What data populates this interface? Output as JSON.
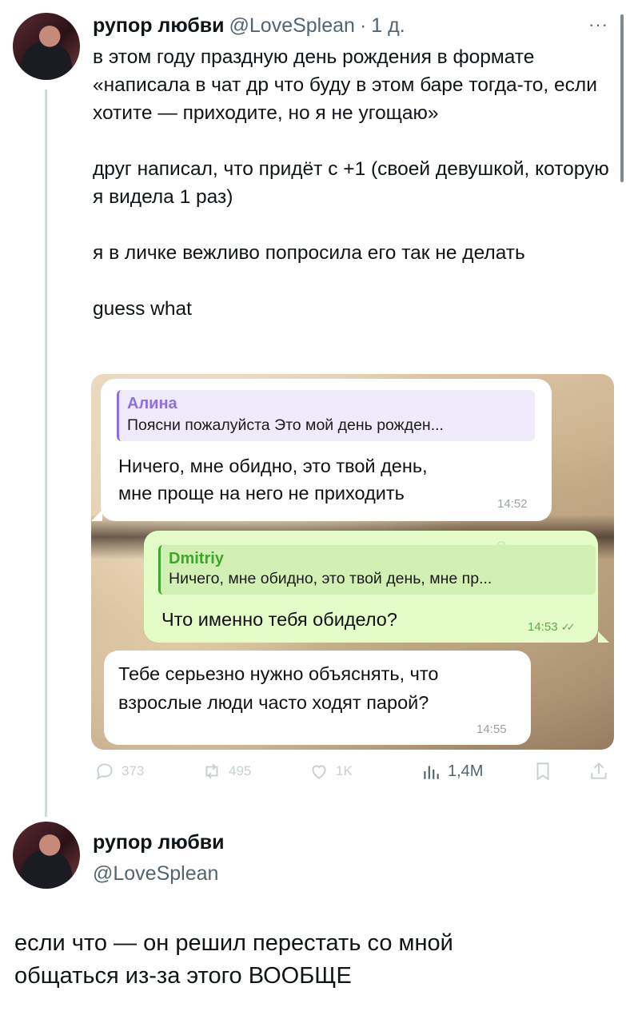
{
  "tweet1": {
    "display_name": "рупор любви",
    "handle": "@LoveSplean",
    "time_sep": "·",
    "time": "1 д.",
    "more_label": "···",
    "paragraphs": [
      "в этом году праздную день рождения в формате «написала в чат др что буду в этом баре тогда-то, если хотите — приходите, но я не угощаю»",
      "друг написал, что придёт с +1 (своей девушкой, которую я видела 1 раз)",
      "я в личке вежливо попросила его так не делать",
      "guess what"
    ],
    "actions": {
      "replies": "373",
      "reposts": "495",
      "likes": "1K",
      "views": "1,4M"
    }
  },
  "chat": {
    "messages": [
      {
        "reply_name": "Алина",
        "reply_text": "Поясни пожалуйста Это мой день рожден...",
        "line1": "Ничего, мне обидно, это твой день,",
        "line2": "мне проще на него не приходить",
        "time": "14:52"
      },
      {
        "reply_name": "Dmitriy",
        "reply_text": "Ничего, мне обидно, это твой день, мне пр...",
        "line1": "Что именно тебя обидело?",
        "time": "14:53",
        "status": "✓✓"
      },
      {
        "line1": "Тебе серьезно нужно объяснять, что",
        "line2": "взрослые люди часто ходят парой?",
        "time": "14:55"
      }
    ]
  },
  "tweet2": {
    "display_name": "рупор любви",
    "handle": "@LoveSplean",
    "line1": "если что — он решил перестать со мной",
    "line2": "общаться из-за этого ВООБЩЕ"
  },
  "colors": {
    "in_bubble": "#ffffff",
    "out_bubble": "#e3fcc8",
    "reply_accent_in": "#8f6fe0",
    "reply_accent_out": "#3ea62b",
    "secondary_text": "#536471"
  },
  "icons": [
    "reply-icon",
    "repost-icon",
    "like-icon",
    "views-icon",
    "bookmark-icon",
    "share-icon",
    "read-checks-icon"
  ]
}
